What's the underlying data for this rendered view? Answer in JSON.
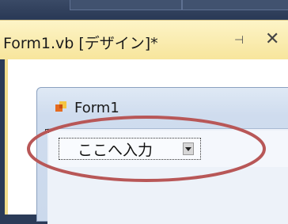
{
  "document_tab": {
    "title": "Form1.vb [デザイン]*",
    "pin_icon": "pin-icon",
    "close_icon": "close-icon"
  },
  "form": {
    "title": "Form1",
    "icon": "form-icon"
  },
  "menu_strip": {
    "placeholder_label": "ここへ入力",
    "dropdown_icon": "chevron-down-icon"
  },
  "annotation": {
    "highlight_color": "#b85757"
  }
}
